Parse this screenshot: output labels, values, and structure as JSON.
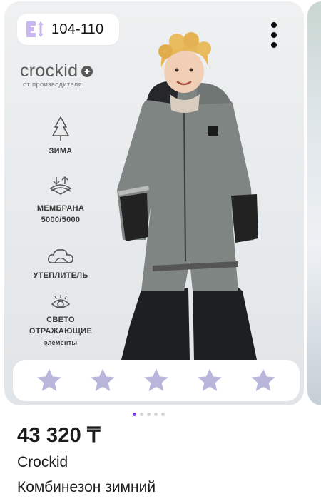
{
  "product": {
    "size_label": "104-110",
    "brand_logo": "crockid",
    "brand_tagline": "от производителя",
    "features": [
      {
        "icon": "snowflake-tree-icon",
        "label": "ЗИМА"
      },
      {
        "icon": "membrane-icon",
        "label_line1": "МЕМБРАНА",
        "label_line2": "5000/5000"
      },
      {
        "icon": "cloud-icon",
        "label": "УТЕПЛИТЕЛЬ"
      },
      {
        "icon": "eye-reflective-icon",
        "label_line1": "СВЕТО",
        "label_line2": "ОТРАЖАЮЩИЕ",
        "label_line3": "элементы"
      }
    ],
    "rating": {
      "stars_total": 5,
      "stars_filled": 0,
      "star_color": "#b9b6dc"
    },
    "pager": {
      "count": 5,
      "active_index": 0,
      "active_color": "#7b3fe4"
    },
    "price": "43 320 ₸",
    "brand": "Crockid",
    "title": "Комбинезон зимний"
  }
}
